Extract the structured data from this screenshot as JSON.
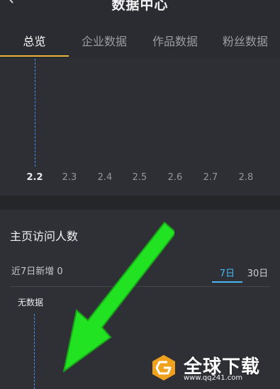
{
  "header": {
    "title": "数据中心",
    "back_icon": "back-arrow-icon"
  },
  "tabs": [
    {
      "label": "总览",
      "active": true
    },
    {
      "label": "企业数据",
      "active": false
    },
    {
      "label": "作品数据",
      "active": false
    },
    {
      "label": "粉丝数据",
      "active": false
    }
  ],
  "overview_chart": {
    "chart_data": {
      "type": "line",
      "x": [
        "2.2",
        "2.3",
        "2.4",
        "2.5",
        "2.6",
        "2.7",
        "2.8"
      ],
      "selected_x": "2.2",
      "series": []
    }
  },
  "visitors": {
    "title": "主页访问人数",
    "subtitle": "近7日新增 0",
    "ranges": [
      {
        "label": "7日",
        "active": true
      },
      {
        "label": "30日",
        "active": false
      }
    ],
    "empty_text": "无数据"
  },
  "overlay": {
    "arrow_color": "#22e322",
    "arrow_icon": "green-pointer-arrow-icon"
  },
  "watermark": {
    "text": "全球下载",
    "url": "www.qq241.com",
    "logo_color": "#f0a21f"
  },
  "colors": {
    "accent_tab": "#e8b43a",
    "accent_range": "#47b8f0",
    "marker_line": "#4a8ef0"
  }
}
